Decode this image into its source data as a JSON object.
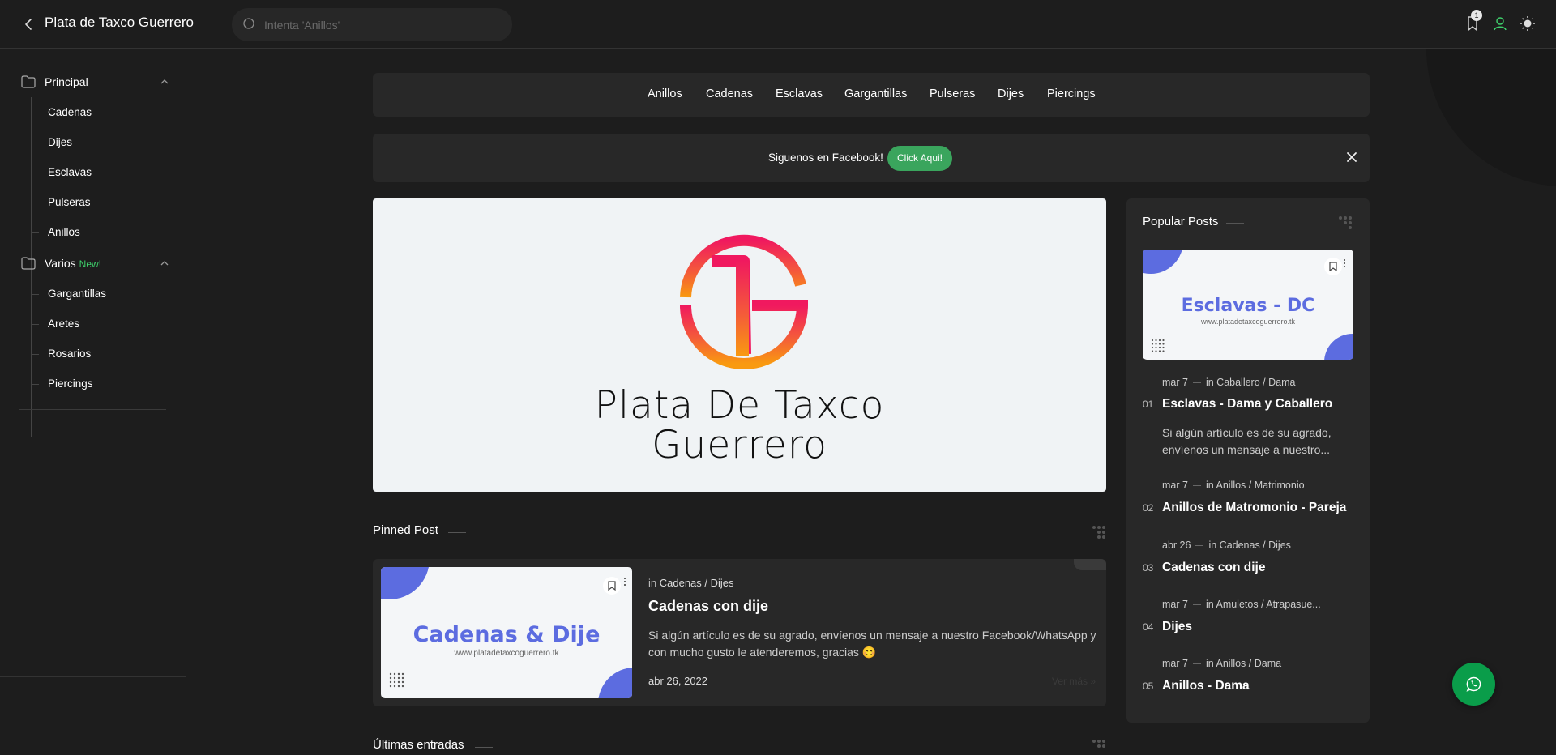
{
  "header": {
    "site_title": "Plata de Taxco Guerrero",
    "search_placeholder": "Intenta 'Anillos'",
    "bookmark_count": "1"
  },
  "sidebar": {
    "sections": [
      {
        "label": "Principal",
        "tag": "",
        "items": [
          "Cadenas",
          "Dijes",
          "Esclavas",
          "Pulseras",
          "Anillos"
        ]
      },
      {
        "label": "Varios",
        "tag": "New!",
        "items": [
          "Gargantillas",
          "Aretes",
          "Rosarios",
          "Piercings"
        ]
      }
    ]
  },
  "nav": {
    "items": [
      "Anillos",
      "Cadenas",
      "Esclavas",
      "Gargantillas",
      "Pulseras",
      "Dijes",
      "Piercings"
    ]
  },
  "facebook_bar": {
    "text": "Siguenos en Facebook!",
    "button": "Click Aqui!"
  },
  "hero": {
    "line1": "Plata De Taxco",
    "line2": "Guerrero"
  },
  "pinned": {
    "section_title": "Pinned Post",
    "thumb_title": "Cadenas & Dije",
    "thumb_url": "www.platadetaxcoguerrero.tk",
    "in": "in",
    "category": "Cadenas / Dijes",
    "title": "Cadenas con dije",
    "desc": "Si algún artículo es de su agrado, envíenos un mensaje a nuestro Facebook/WhatsApp y con mucho gusto le atenderemos, gracias 😊",
    "date": "abr 26, 2022",
    "more": "Ver más »"
  },
  "popular": {
    "section_title": "Popular Posts",
    "thumb_title": "Esclavas - DC",
    "thumb_url": "www.platadetaxcoguerrero.tk",
    "items": [
      {
        "num": "01",
        "date": "mar 7",
        "in": "in",
        "category": "Caballero / Dama",
        "title": "Esclavas - Dama y Caballero",
        "desc": "Si algún artículo es de su agrado, envíenos un mensaje a nuestro..."
      },
      {
        "num": "02",
        "date": "mar 7",
        "in": "in",
        "category": "Anillos / Matrimonio",
        "title": "Anillos de Matromonio - Pareja"
      },
      {
        "num": "03",
        "date": "abr 26",
        "in": "in",
        "category": "Cadenas / Dijes",
        "title": "Cadenas con dije"
      },
      {
        "num": "04",
        "date": "mar 7",
        "in": "in",
        "category": "Amuletos / Atrapasue...",
        "title": "Dijes"
      },
      {
        "num": "05",
        "date": "mar 7",
        "in": "in",
        "category": "Anillos / Dama",
        "title": "Anillos - Dama"
      }
    ]
  },
  "latest": {
    "section_title": "Últimas entradas"
  },
  "colors": {
    "background": "#1d1d1d",
    "card": "#282828",
    "accent_green": "#3aa55d",
    "whatsapp": "#0a9d4a",
    "thumb_blue": "#5c6ce0"
  },
  "icons": [
    "back-icon",
    "search-icon",
    "bookmark-icon",
    "user-icon",
    "theme-toggle-icon",
    "folder-icon",
    "chevron-up-icon",
    "close-icon",
    "grip-icon",
    "whatsapp-icon",
    "dots-icon"
  ]
}
